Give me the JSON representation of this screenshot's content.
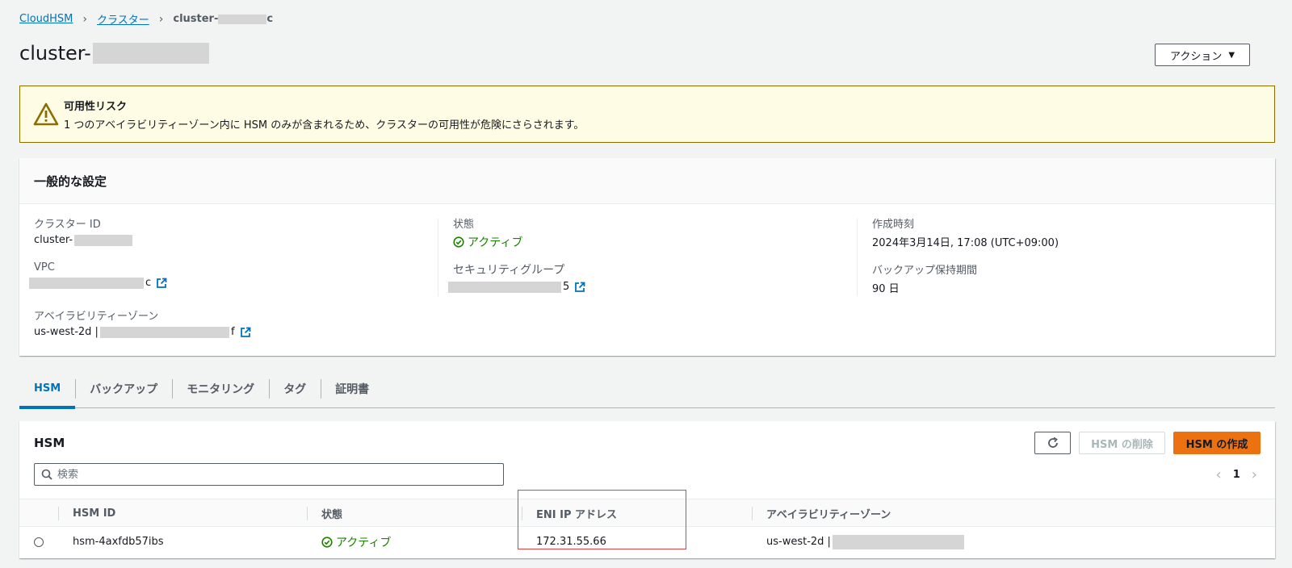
{
  "breadcrumb": {
    "root": "CloudHSM",
    "clusters": "クラスター",
    "current_prefix": "cluster-",
    "current_suffix": "c"
  },
  "page": {
    "title_prefix": "cluster-",
    "action_label": "アクション"
  },
  "alert": {
    "title": "可用性リスク",
    "body": "1 つのアベイラビリティーゾーン内に HSM のみが含まれるため、クラスターの可用性が危険にさらされます。",
    "color": "#8c6e00"
  },
  "general": {
    "heading": "一般的な設定",
    "cluster_id_label": "クラスター ID",
    "cluster_id_prefix": "cluster-",
    "status_label": "状態",
    "status_value": "アクティブ",
    "created_label": "作成時刻",
    "created_value": "2024年3月14日, 17:08 (UTC+09:00)",
    "vpc_label": "VPC",
    "vpc_suffix": "c",
    "sg_label": "セキュリティグループ",
    "sg_suffix": "5",
    "backup_label": "バックアップ保持期間",
    "backup_value": "90 日",
    "az_label": "アベイラビリティーゾーン",
    "az_prefix": "us-west-2d |",
    "az_suffix": "f"
  },
  "tabs": [
    {
      "label": "HSM",
      "active": true
    },
    {
      "label": "バックアップ",
      "active": false
    },
    {
      "label": "モニタリング",
      "active": false
    },
    {
      "label": "タグ",
      "active": false
    },
    {
      "label": "証明書",
      "active": false
    }
  ],
  "hsm": {
    "heading": "HSM",
    "delete_label": "HSM の削除",
    "create_label": "HSM の作成",
    "search_placeholder": "検索",
    "page": "1",
    "columns": {
      "id": "HSM ID",
      "status": "状態",
      "eni": "ENI IP アドレス",
      "az": "アベイラビリティーゾーン"
    },
    "rows": [
      {
        "id": "hsm-4axfdb57ibs",
        "status": "アクティブ",
        "eni": "172.31.55.66",
        "az": "us-west-2d |"
      }
    ]
  },
  "colors": {
    "accent": "#0073bb",
    "success": "#1d8102",
    "primary_button": "#ec7211",
    "highlight": "#e0404a"
  }
}
